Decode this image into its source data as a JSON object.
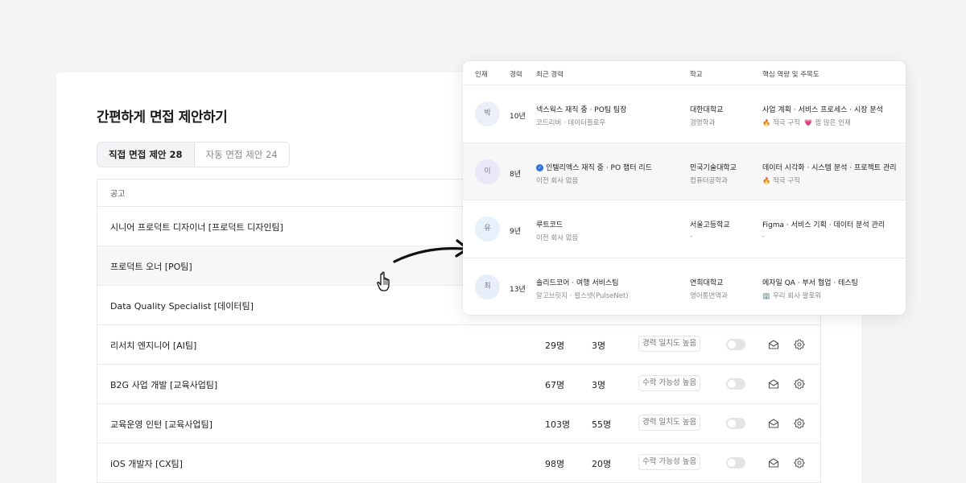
{
  "page": {
    "title": "간편하게 면접 제안하기"
  },
  "tabs": [
    {
      "label": "직접 면접 제안 28",
      "active": true
    },
    {
      "label": "자동 면접 제안 24",
      "active": false
    }
  ],
  "table": {
    "header_label": "공고",
    "rows": [
      {
        "name": "시니어 프로덕트 디자이너 [프로덕트 디자인팀]",
        "c1": "",
        "c2": "",
        "badge": ""
      },
      {
        "name": "프로덕트 오너 [PO팀]",
        "c1": "",
        "c2": "",
        "badge": ""
      },
      {
        "name": "Data Quality Specialist [데이터팀]",
        "c1": "",
        "c2": "",
        "badge": ""
      },
      {
        "name": "리서치 엔지니어 [AI팀]",
        "c1": "29명",
        "c2": "3명",
        "badge": "경력 일치도 높음"
      },
      {
        "name": "B2G 사업 개발 [교육사업팀]",
        "c1": "67명",
        "c2": "3명",
        "badge": "수락 가능성 높음"
      },
      {
        "name": "교육운영 인턴 [교육사업팀]",
        "c1": "103명",
        "c2": "55명",
        "badge": "경력 일치도 높음"
      },
      {
        "name": "iOS 개발자 [CX팀]",
        "c1": "98명",
        "c2": "20명",
        "badge": "수락 가능성 높음"
      }
    ]
  },
  "popup": {
    "headers": {
      "talent": "인재",
      "career": "경력",
      "recent": "최근 경력",
      "school": "학교",
      "skills": "핵심 역량 및 주목도"
    },
    "rows": [
      {
        "avatar": "박",
        "avatar_color": "#eceef8",
        "years": "10년",
        "recent": "넥스웍스 재직 중 · PO팀 팀장",
        "recent_sub": "코드리버 · 데이터플로우",
        "verified": false,
        "school": "대한대학교",
        "major": "경영학과",
        "skills": "사업 계획 · 서비스 프로세스 · 시장 분석",
        "tags": [
          {
            "icon": "fire-icon",
            "text": "적극 구직"
          },
          {
            "icon": "heart-icon",
            "text": "찜 많은 인재"
          }
        ]
      },
      {
        "avatar": "이",
        "avatar_color": "#ebe8f7",
        "years": "8년",
        "recent": "인텔리엑스 재직 중 · PO 챕터 리드",
        "recent_sub": "이전 회사 없음",
        "verified": true,
        "school": "민국기술대학교",
        "major": "컴퓨터공학과",
        "skills": "데이터 시각화 · 시스템 분석 · 프로젝트 관리",
        "tags": [
          {
            "icon": "fire-icon",
            "text": "적극 구직"
          }
        ]
      },
      {
        "avatar": "유",
        "avatar_color": "#e6f1fb",
        "years": "9년",
        "recent": "루트코드",
        "recent_sub": "이전 회사 없음",
        "verified": false,
        "school": "서울고등학교",
        "major": "-",
        "skills": "Figma · 서비스 기획 · 데이터 분석 관리",
        "tags": [
          {
            "icon": "",
            "text": "-"
          }
        ]
      },
      {
        "avatar": "최",
        "avatar_color": "#e8eef9",
        "years": "13년",
        "recent": "솔리드코어 · 여행 서비스팀",
        "recent_sub": "알고브릿지 · 펄스넷(PulseNet)",
        "verified": false,
        "school": "연희대학교",
        "major": "영어통번역과",
        "skills": "에자일 QA · 부서 협업 · 테스팅",
        "tags": [
          {
            "icon": "building-icon",
            "text": "우리 회사 팔로워"
          }
        ]
      }
    ]
  }
}
